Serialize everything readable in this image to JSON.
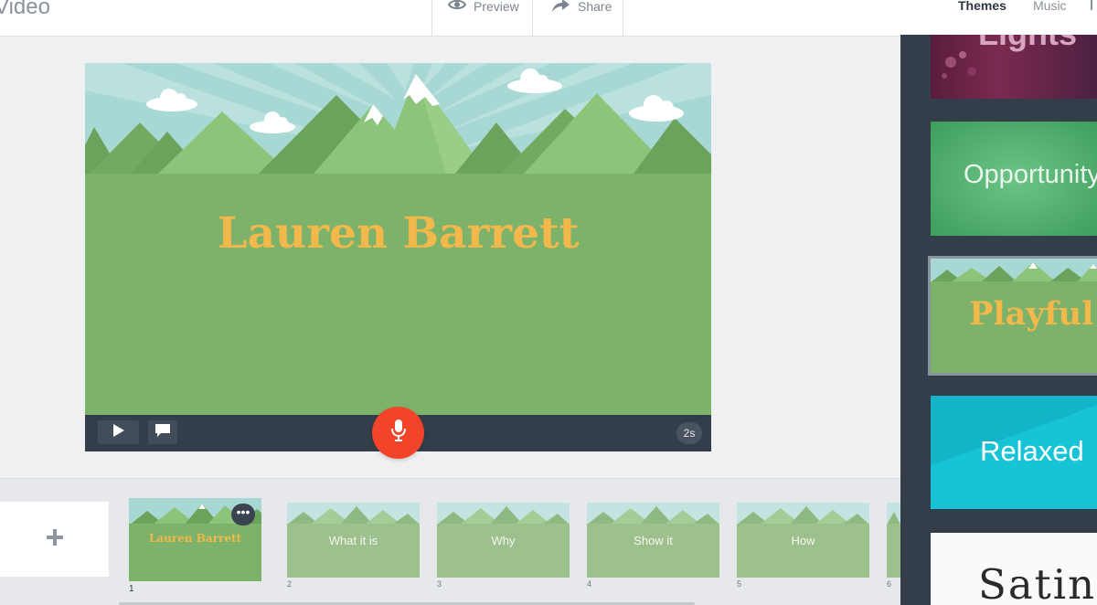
{
  "app": {
    "title": "Video"
  },
  "toolbar": {
    "preview_label": "Preview",
    "share_label": "Share",
    "tabs": [
      {
        "label": "Themes",
        "active": true
      },
      {
        "label": "Music",
        "active": false
      }
    ]
  },
  "stage": {
    "title": "Lauren Barrett",
    "duration": "2s"
  },
  "slides": [
    {
      "number": "1",
      "label": "Lauren Barrett",
      "active": true
    },
    {
      "number": "2",
      "label": "What it is",
      "active": false
    },
    {
      "number": "3",
      "label": "Why",
      "active": false
    },
    {
      "number": "4",
      "label": "Show it",
      "active": false
    },
    {
      "number": "5",
      "label": "How",
      "active": false
    },
    {
      "number": "6",
      "label": "",
      "active": false
    }
  ],
  "themes": [
    {
      "name": "Lights",
      "selected": false
    },
    {
      "name": "Opportunity",
      "selected": false
    },
    {
      "name": "Playful",
      "selected": true
    },
    {
      "name": "Relaxed",
      "selected": false
    },
    {
      "name": "Satin",
      "selected": false
    }
  ],
  "colors": {
    "accent_record": "#f1442b",
    "title_gold": "#f2b84b",
    "grass_green": "#7db26a",
    "dark_panel": "#343e4a"
  },
  "icons": {
    "preview": "eye-icon",
    "share": "share-arrow-icon",
    "play": "play-icon",
    "comment": "speech-bubble-icon",
    "record": "microphone-icon",
    "add": "plus-icon",
    "more": "ellipsis-icon"
  }
}
